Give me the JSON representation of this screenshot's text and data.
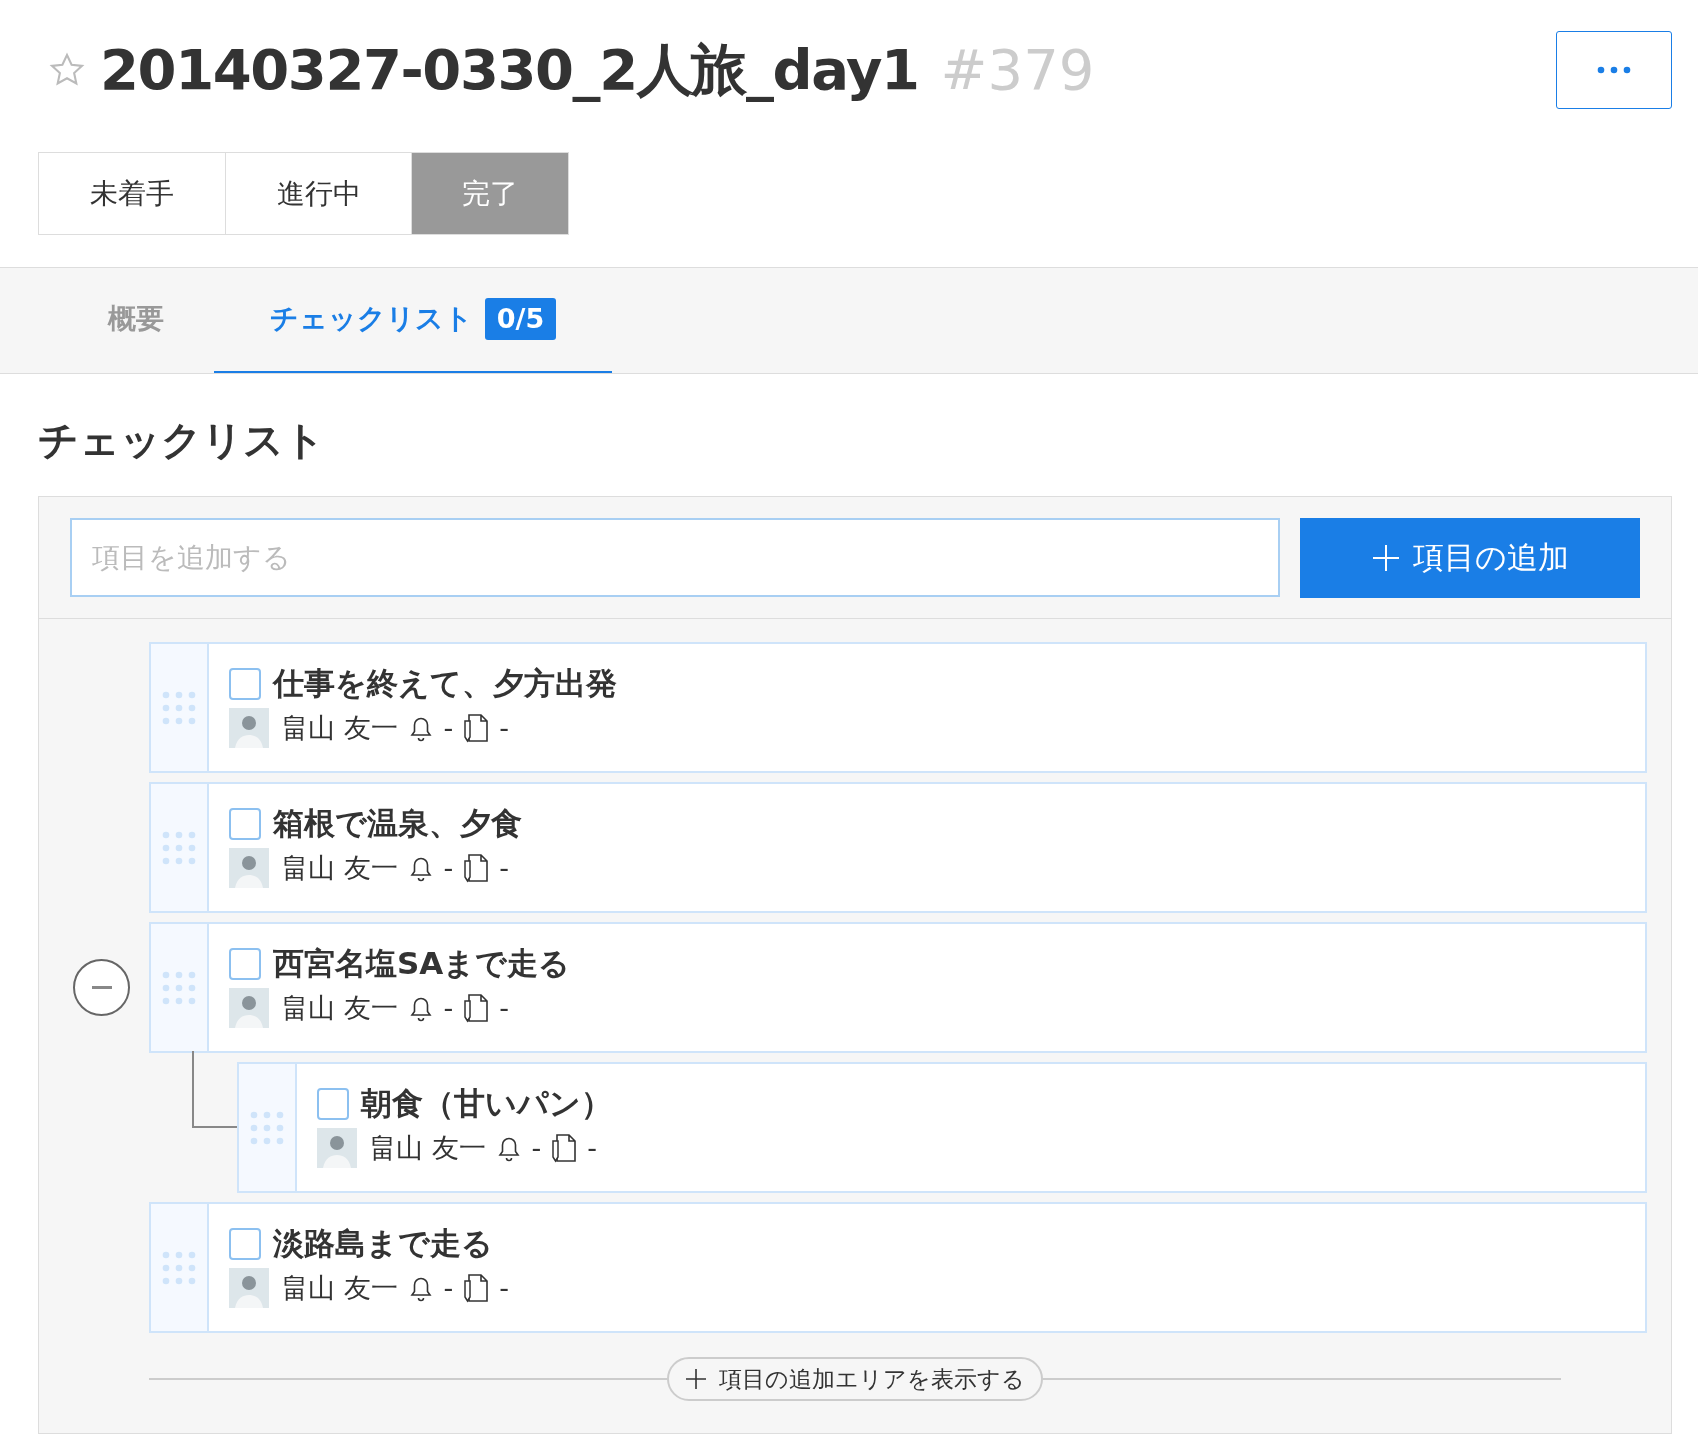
{
  "header": {
    "starred": false,
    "title": "20140327-0330_2人旅_day1",
    "number": "#379"
  },
  "status_buttons": [
    {
      "label": "未着手",
      "selected": false
    },
    {
      "label": "進行中",
      "selected": false
    },
    {
      "label": "完了",
      "selected": true
    }
  ],
  "tabs": [
    {
      "label": "概要",
      "selected": false
    },
    {
      "label": "チェックリスト",
      "selected": true,
      "badge": "0/5"
    }
  ],
  "checklist": {
    "heading": "チェックリスト",
    "input": {
      "placeholder": "項目を追加する"
    },
    "add_button": "項目の追加",
    "items": [
      {
        "title": "仕事を終えて、夕方出発",
        "checked": false,
        "assignee": "畠山 友一",
        "reminder": "-",
        "note": "-"
      },
      {
        "title": "箱根で温泉、夕食",
        "checked": false,
        "assignee": "畠山 友一",
        "reminder": "-",
        "note": "-"
      },
      {
        "title": "西宮名塩SAまで走る",
        "checked": false,
        "assignee": "畠山 友一",
        "reminder": "-",
        "note": "-",
        "expanded": true,
        "children": [
          {
            "title": "朝食（甘いパン）",
            "checked": false,
            "assignee": "畠山 友一",
            "reminder": "-",
            "note": "-"
          }
        ]
      },
      {
        "title": "淡路島まで走る",
        "checked": false,
        "assignee": "畠山 友一",
        "reminder": "-",
        "note": "-"
      }
    ],
    "show_add_area": "項目の追加エリアを表示する"
  }
}
